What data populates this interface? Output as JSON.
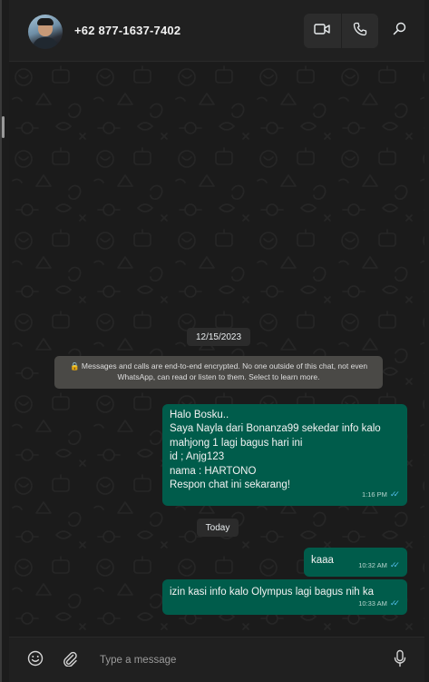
{
  "header": {
    "contact_name": "+62 877-1637-7402",
    "avatar_icon": "contact-photo",
    "video_call_icon": "video-camera-icon",
    "voice_call_icon": "phone-icon",
    "search_icon": "search-icon"
  },
  "chat": {
    "date_chip_1": "12/15/2023",
    "encryption_notice": "🔒 Messages and calls are end-to-end encrypted. No one outside of this chat, not even WhatsApp, can read or listen to them. Select to learn more.",
    "date_chip_2": "Today",
    "messages": [
      {
        "text": "Halo Bosku..\nSaya Nayla dari Bonanza99 sekedar info kalo mahjong 1 lagi bagus  hari ini\nid ; Anjg123\nnama : HARTONO\nRespon chat ini sekarang!",
        "time": "1:16 PM",
        "status": "read"
      },
      {
        "text": "kaaa",
        "time": "10:32 AM",
        "status": "read"
      },
      {
        "text": "izin kasi info kalo Olympus lagi  bagus nih ka",
        "time": "10:33 AM",
        "status": "read"
      }
    ]
  },
  "composer": {
    "placeholder": "Type a message",
    "emoji_icon": "emoji-icon",
    "attach_icon": "paperclip-icon",
    "mic_icon": "microphone-icon"
  },
  "colors": {
    "outgoing_bubble": "#005c4b",
    "read_ticks": "#53bdeb",
    "background": "#1b1b1b"
  }
}
